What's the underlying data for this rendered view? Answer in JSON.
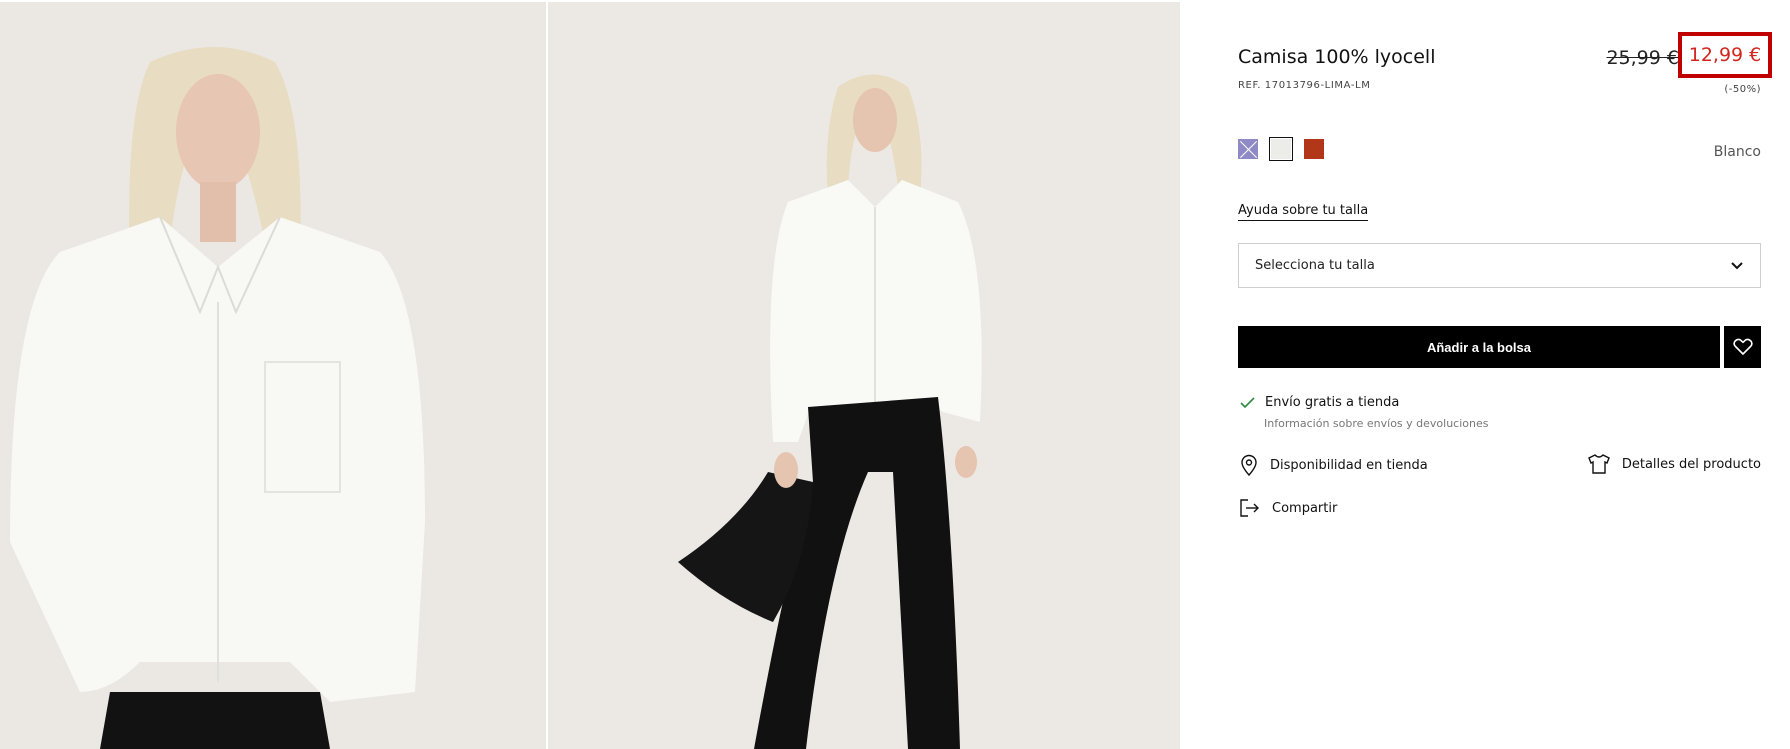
{
  "product": {
    "title": "Camisa 100% lyocell",
    "ref": "REF. 17013796-LIMA-LM",
    "old_price": "25,99 €",
    "new_price": "12,99 €",
    "discount": "(-50%)"
  },
  "colors": {
    "selected_name": "Blanco",
    "swatches": [
      {
        "name": "lilac",
        "hex": "#8f8ac6",
        "available": false
      },
      {
        "name": "white",
        "hex": "#ecece8",
        "selected": true
      },
      {
        "name": "rust",
        "hex": "#b23618"
      }
    ]
  },
  "size": {
    "help_link": "Ayuda sobre tu talla",
    "select_placeholder": "Selecciona tu talla"
  },
  "actions": {
    "add_to_bag": "Añadir a la bolsa"
  },
  "shipping": {
    "label": "Envío gratis a tienda",
    "sub_label": "Información sobre envíos y devoluciones"
  },
  "links": {
    "store_availability": "Disponibilidad en tienda",
    "product_details": "Detalles del producto",
    "share": "Compartir"
  },
  "theme": {
    "price_red": "#d0261e",
    "highlight_border": "#c00000",
    "button_black": "#000000"
  }
}
